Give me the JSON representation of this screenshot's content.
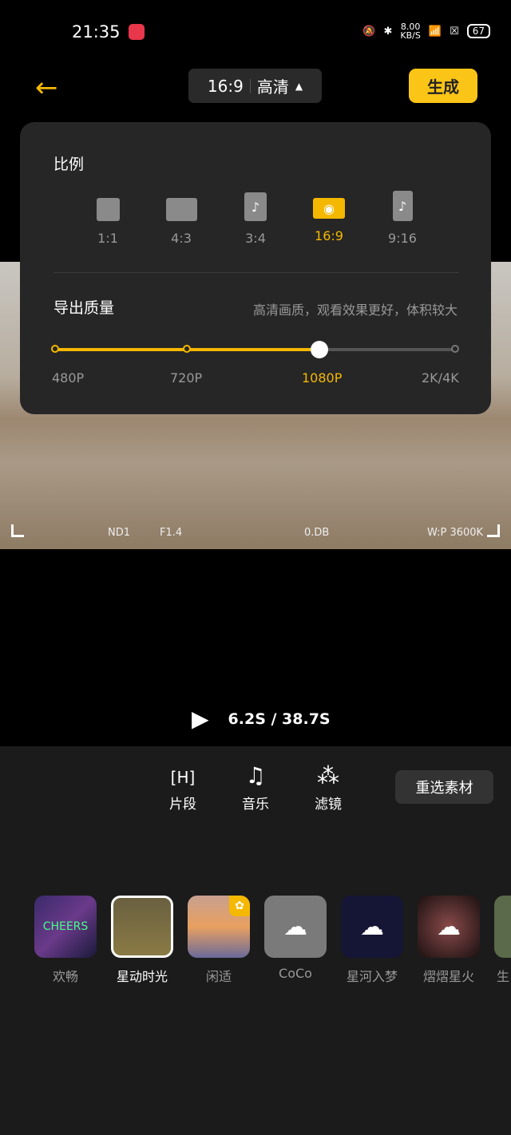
{
  "status": {
    "time": "21:35",
    "speed": "8.00",
    "speed_unit": "KB/S",
    "battery": "67"
  },
  "header": {
    "ratio": "16:9",
    "quality": "高清",
    "generate": "生成"
  },
  "panel": {
    "ratio_title": "比例",
    "ratios": [
      {
        "label": "1:1"
      },
      {
        "label": "4:3"
      },
      {
        "label": "3:4",
        "icon": "♪"
      },
      {
        "label": "16:9",
        "icon": "◉"
      },
      {
        "label": "9:16",
        "icon": "♪"
      }
    ],
    "selected_ratio": "16:9",
    "quality_title": "导出质量",
    "quality_desc": "高清画质，观看效果更好，体积较大",
    "qualities": [
      "480P",
      "720P",
      "1080P",
      "2K/4K"
    ],
    "selected_quality": "1080P",
    "accent": "#f5b800"
  },
  "video": {
    "overlay": [
      "ND1",
      "F1.4",
      "0.DB",
      "W:P 3600K"
    ]
  },
  "player": {
    "time": "6.2S / 38.7S"
  },
  "tools": [
    {
      "label": "片段",
      "icon": "[H]"
    },
    {
      "label": "音乐",
      "icon": "♫"
    },
    {
      "label": "滤镜",
      "icon": "⁂"
    }
  ],
  "reselect": "重选素材",
  "music": [
    {
      "label": "欢畅"
    },
    {
      "label": "星动时光"
    },
    {
      "label": "闲适"
    },
    {
      "label": "CoCo"
    },
    {
      "label": "星河入梦"
    },
    {
      "label": "熠熠星火"
    },
    {
      "label": "生"
    }
  ]
}
